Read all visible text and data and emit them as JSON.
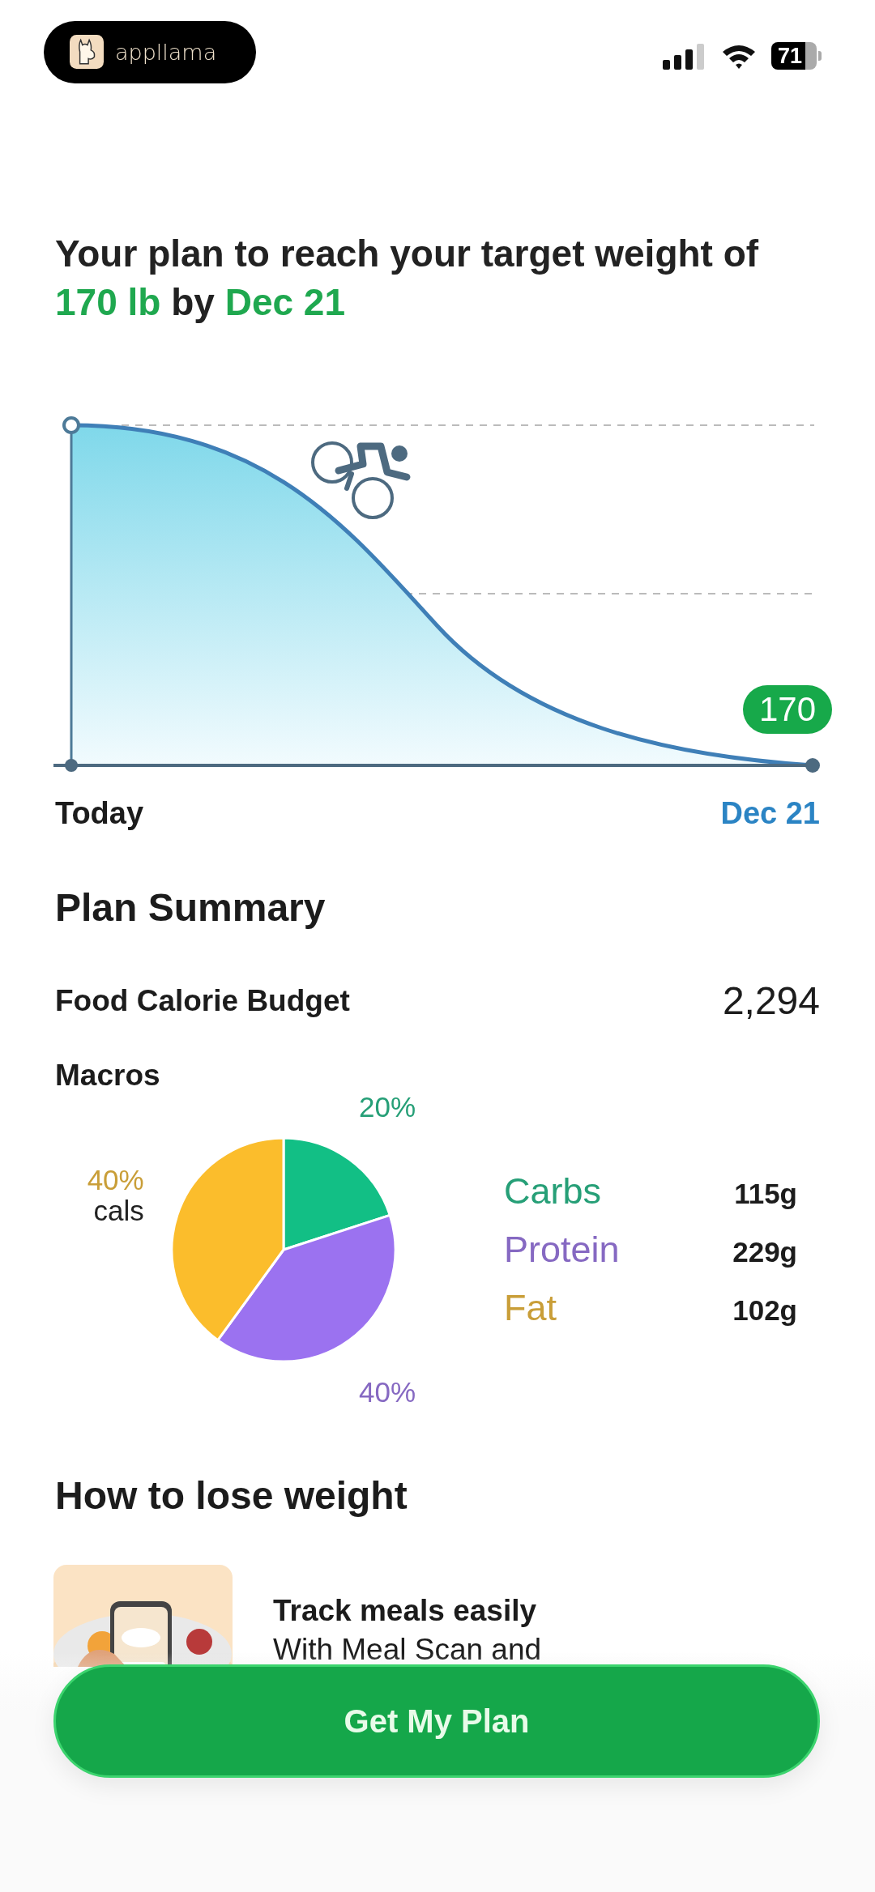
{
  "status_bar": {
    "app_name": "appllama",
    "battery": "71"
  },
  "headline": [
    {
      "text": "Your plan to reach your target weight of ",
      "highlight": false
    },
    {
      "text": "170 lb",
      "highlight": true
    },
    {
      "text": " by ",
      "highlight": false
    },
    {
      "text": "Dec 21",
      "highlight": true
    }
  ],
  "weight_chart": {
    "start_label": "Today",
    "end_label": "Dec 21",
    "target_badge": "170"
  },
  "plan_summary": {
    "title": "Plan Summary",
    "budget_label": "Food Calorie Budget",
    "budget_value": "2,294",
    "macros_title": "Macros"
  },
  "macros": {
    "chart_data": {
      "type": "pie",
      "categories": [
        "Carbs",
        "Protein",
        "Fat"
      ],
      "values": [
        20,
        40,
        40
      ],
      "value_labels": [
        "20%",
        "40%",
        "40%"
      ],
      "annotations": [
        "cals"
      ]
    },
    "items": [
      {
        "amount": "115g",
        "color": "#12bf85"
      },
      {
        "amount": "229g",
        "color": "#9b72f0"
      },
      {
        "amount": "102g",
        "color": "#fbbd2c"
      }
    ]
  },
  "how_to": {
    "title": "How to lose weight",
    "card_title": "Track meals easily",
    "card_text": "With Meal Scan and"
  },
  "cta": {
    "label": "Get My Plan"
  }
}
